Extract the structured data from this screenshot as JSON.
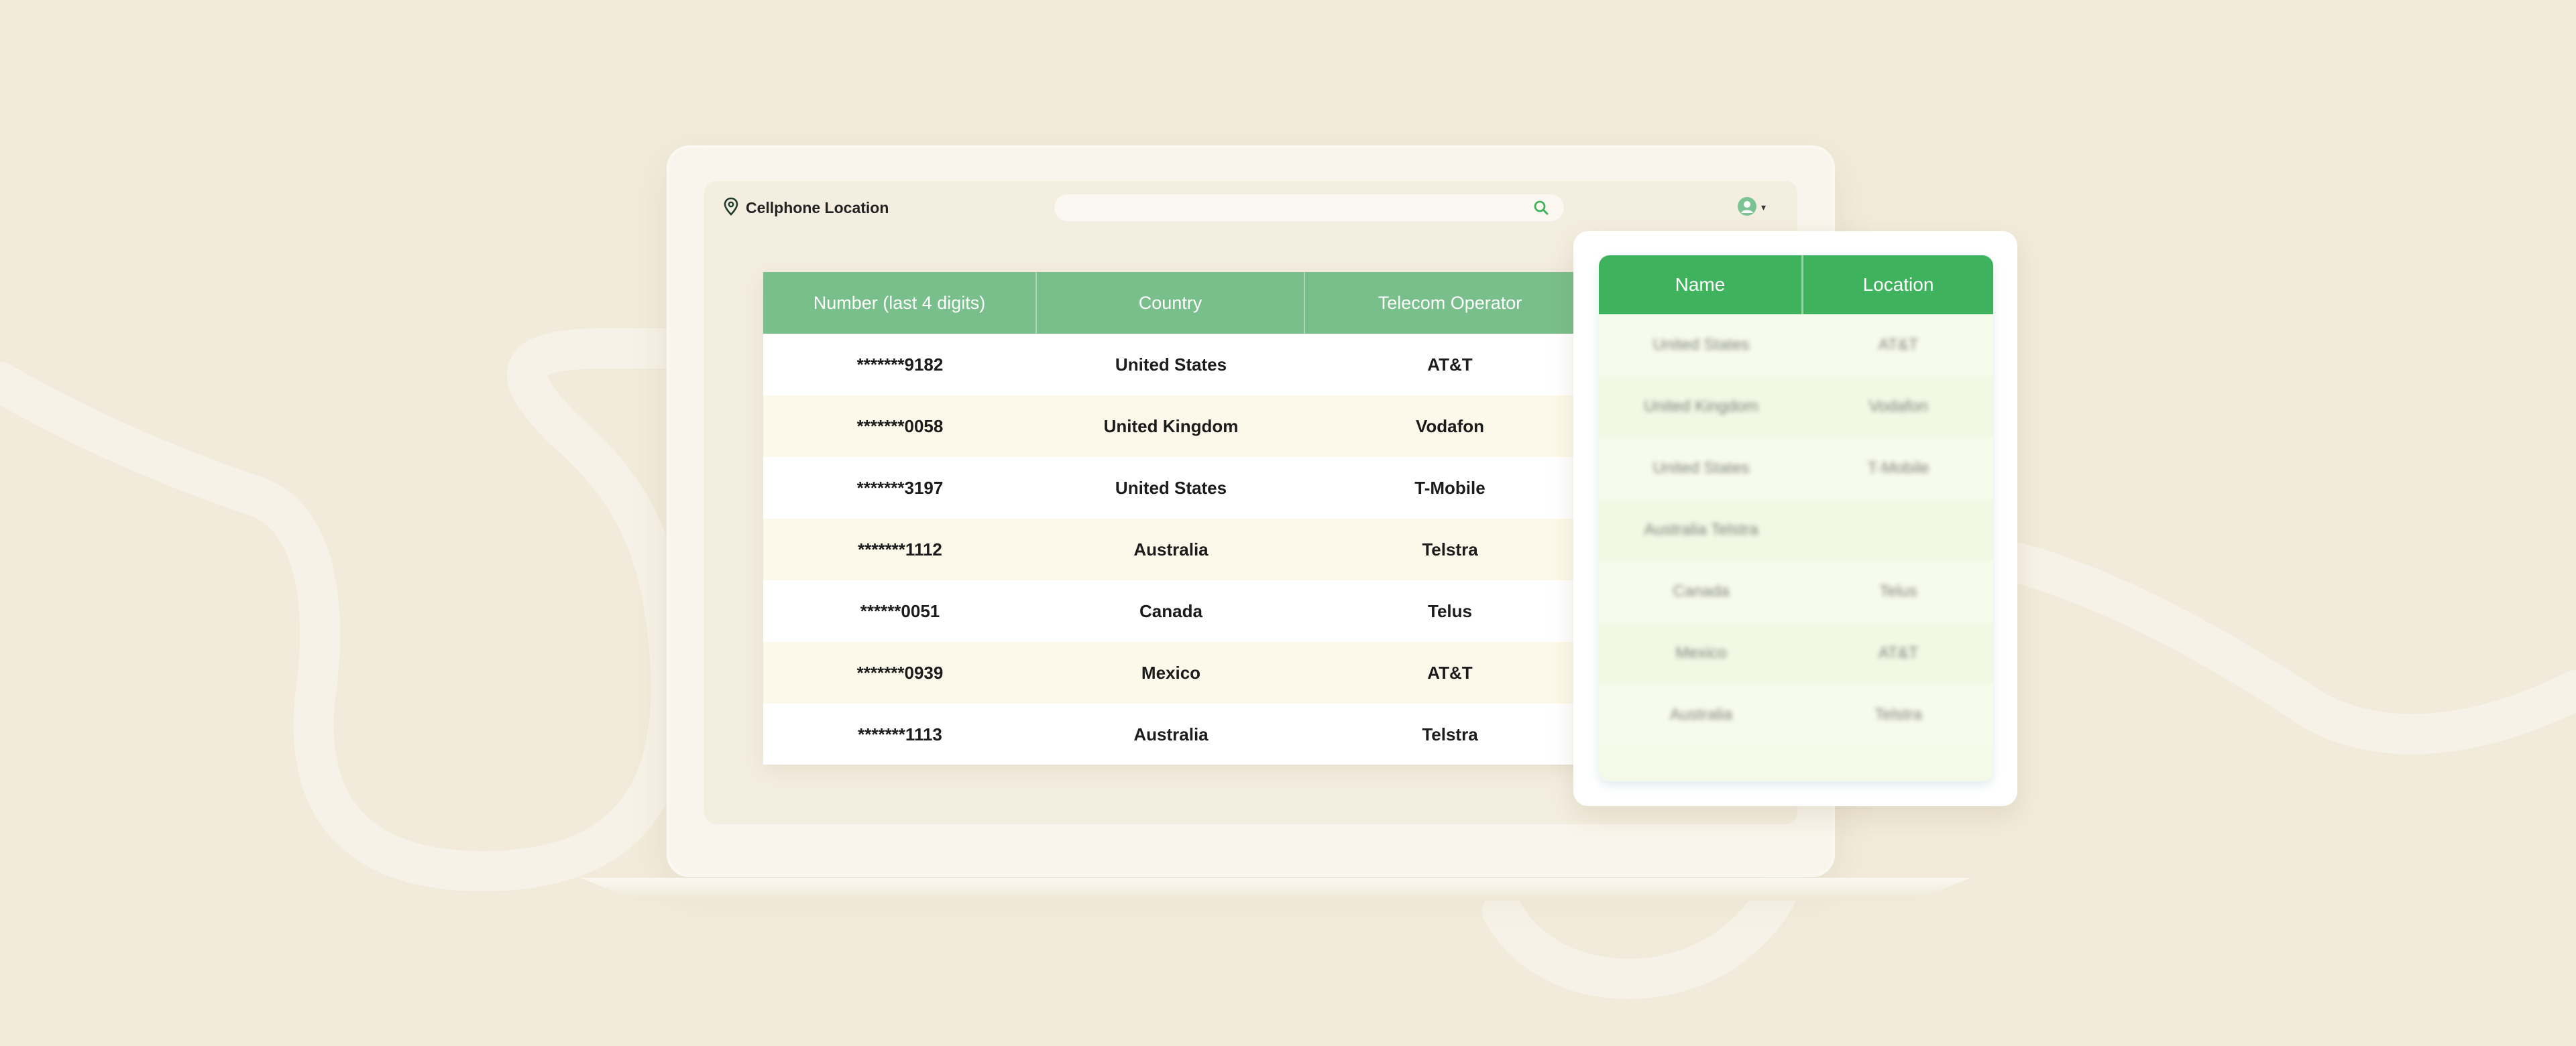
{
  "colors": {
    "background": "#f2ebdb",
    "table_header": "#79bf8b",
    "popup_header": "#3fb25d",
    "row_alt": "#fdf9ea"
  },
  "header": {
    "brand": "Cellphone Location",
    "brand_icon": "location-pin-icon",
    "search_icon": "search-icon",
    "user_icon": "user-avatar-icon",
    "user_caret": "▾"
  },
  "main_table": {
    "columns": [
      "Number (last 4 digits)",
      "Country",
      "Telecom Operator"
    ],
    "rows": [
      [
        "*******9182",
        "United States",
        "AT&T"
      ],
      [
        "*******0058",
        "United Kingdom",
        "Vodafon"
      ],
      [
        "*******3197",
        "United States",
        "T-Mobile"
      ],
      [
        "*******1112",
        "Australia",
        "Telstra"
      ],
      [
        "******0051",
        "Canada",
        "Telus"
      ],
      [
        "*******0939",
        "Mexico",
        "AT&T"
      ],
      [
        "*******1113",
        "Australia",
        "Telstra"
      ]
    ]
  },
  "popup_table": {
    "columns": [
      "Name",
      "Location"
    ],
    "rows": [
      [
        "United States",
        "AT&T"
      ],
      [
        "United Kingdom",
        "Vodafon"
      ],
      [
        "United States",
        "T-Mobile"
      ],
      [
        "Australia Telstra",
        ""
      ],
      [
        "Canada",
        "Telus"
      ],
      [
        "Mexico",
        "AT&T"
      ],
      [
        "Australia",
        "Telstra"
      ]
    ]
  }
}
